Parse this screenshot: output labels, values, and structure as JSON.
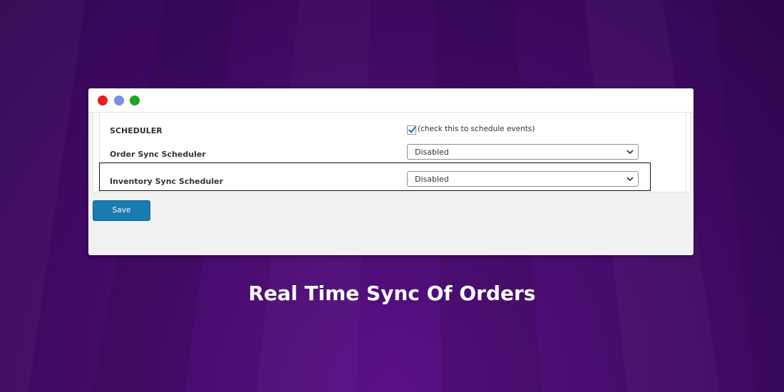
{
  "window": {
    "controls": [
      "close",
      "minimize",
      "maximize"
    ]
  },
  "settings": {
    "scheduler_label": "SCHEDULER",
    "scheduler_checked": true,
    "scheduler_hint": "(check this to schedule events)",
    "order_sync_label": "Order Sync Scheduler",
    "order_sync_value": "Disabled",
    "inventory_sync_label": "Inventory Sync Scheduler",
    "inventory_sync_value": "Disabled"
  },
  "actions": {
    "save_label": "Save"
  },
  "headline": "Real Time Sync Of Orders",
  "colors": {
    "accent_button": "#1a7bb0",
    "close_dot": "#ee1c1c",
    "minimize_dot": "#7a8ee6",
    "maximize_dot": "#21a321",
    "background": "#46096a"
  },
  "icons": [
    "checkmark-icon",
    "chevron-down-icon"
  ]
}
